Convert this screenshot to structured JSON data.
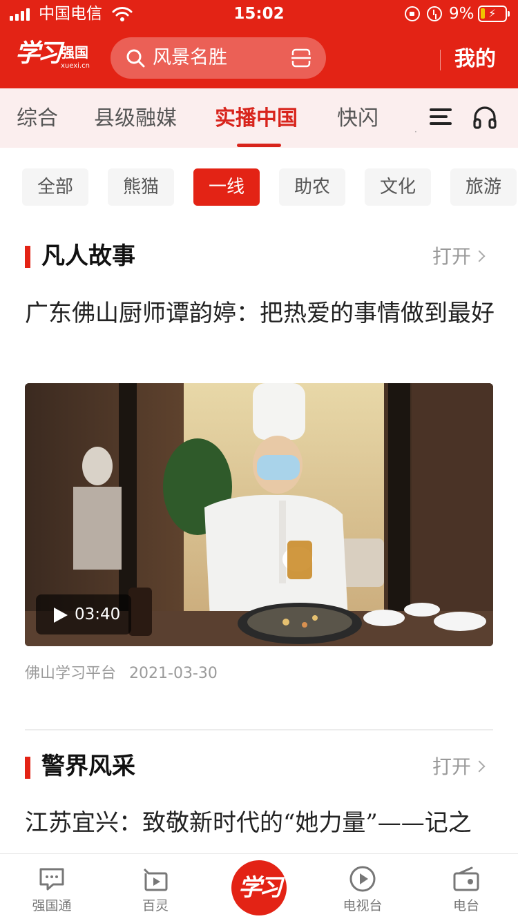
{
  "status_bar": {
    "carrier": "中国电信",
    "time": "15:02",
    "battery": "9%"
  },
  "header": {
    "logo_text": "学习",
    "logo_name": "强国",
    "logo_domain": "xuexi.cn",
    "search_placeholder": "风景名胜",
    "mine_label": "我的"
  },
  "channels": [
    "综合",
    "县级融媒",
    "实播中国",
    "快闪"
  ],
  "active_channel": "实播中国",
  "categories": [
    "全部",
    "熊猫",
    "一线",
    "助农",
    "文化",
    "旅游"
  ],
  "active_category": "一线",
  "sections": [
    {
      "title": "凡人故事",
      "open_label": "打开",
      "article": {
        "title": "广东佛山厨师谭韵婷：把热爱的事情做到最好",
        "video_duration": "03:40",
        "source": "佛山学习平台",
        "date": "2021-03-30"
      }
    },
    {
      "title": "警界风采",
      "open_label": "打开",
      "article": {
        "title": "江苏宜兴：致敬新时代的“她力量”——记之"
      }
    }
  ],
  "bottom_tabs": [
    "强国通",
    "百灵",
    "学习",
    "电视台",
    "电台"
  ],
  "colors": {
    "brand_red": "#e32315",
    "active_tab_red": "#d8241c",
    "channel_bar_bg": "#fbeeee"
  }
}
